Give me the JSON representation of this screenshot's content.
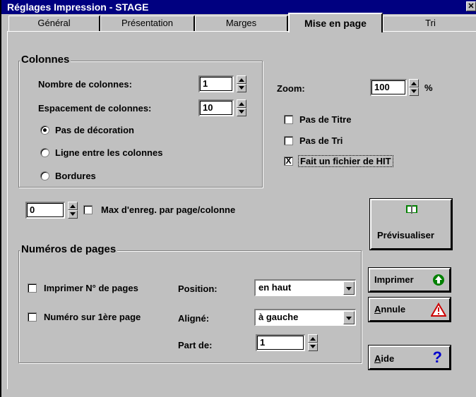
{
  "window": {
    "title": "Réglages Impression - STAGE",
    "close_glyph": "✕"
  },
  "tabs": [
    {
      "label": "Général"
    },
    {
      "label": "Présentation"
    },
    {
      "label": "Marges"
    },
    {
      "label": "Mise en page",
      "active": true
    },
    {
      "label": "Tri"
    }
  ],
  "colonnes": {
    "title": "Colonnes",
    "nb_label": "Nombre de colonnes:",
    "nb_value": "1",
    "esp_label": "Espacement de colonnes:",
    "esp_value": "10",
    "radios": [
      {
        "label": "Pas de décoration",
        "checked": true
      },
      {
        "label": "Ligne entre les colonnes",
        "checked": false
      },
      {
        "label": "Bordures",
        "checked": false
      }
    ]
  },
  "zoom": {
    "label": "Zoom:",
    "value": "100",
    "unit": "%"
  },
  "options": [
    {
      "label": "Pas de Titre",
      "checked": false
    },
    {
      "label": "Pas de Tri",
      "checked": false
    },
    {
      "label": "Fait un fichier de HIT",
      "checked": true,
      "mark": "X"
    }
  ],
  "max_enreg": {
    "value": "0",
    "label": "Max d'enreg. par page/colonne",
    "checked": false
  },
  "numeros": {
    "title": "Numéros de pages",
    "imprimer_label": "Imprimer N° de pages",
    "numero_label": "Numéro sur 1ère page",
    "position_label": "Position:",
    "position_value": "en haut",
    "aligne_label": "Aligné:",
    "aligne_value": "à gauche",
    "part_label": "Part de:",
    "part_value": "1"
  },
  "buttons": {
    "previsualiser": "Prévisualiser",
    "imprimer": "Imprimer",
    "annule_first": "A",
    "annule_rest": "nnule",
    "aide_first": "A",
    "aide_rest": "ide",
    "aide_glyph": "?"
  },
  "colors": {
    "title_bar": "#000080",
    "face": "#c0c0c0",
    "imprimer_icon": "#008000",
    "annule_icon": "#cc0000",
    "aide_icon": "#0000cc"
  }
}
